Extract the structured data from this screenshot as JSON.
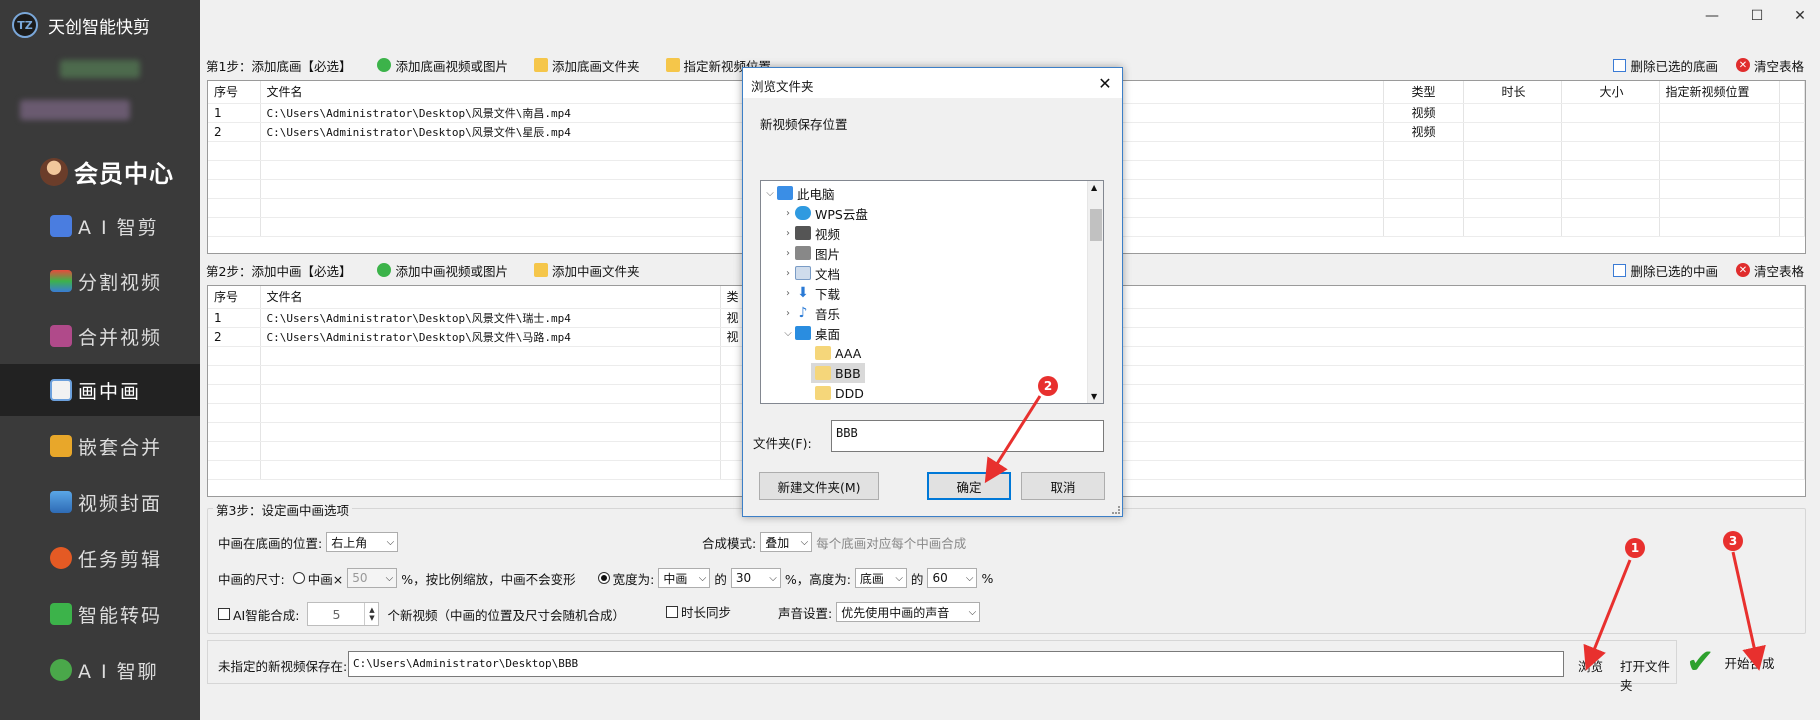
{
  "app": {
    "title": "天创智能快剪",
    "logo_text": "TZ"
  },
  "window": {
    "minimize": "—",
    "maximize": "☐",
    "close": "✕"
  },
  "sidebar": {
    "member_label": "会员中心",
    "items": [
      {
        "label": "A I 智剪",
        "icon": "ai-edit-icon",
        "color": "#4a7de0"
      },
      {
        "label": "分割视频",
        "icon": "split-video-icon",
        "color": "#3cb34a"
      },
      {
        "label": "合并视频",
        "icon": "merge-video-icon",
        "color": "#b04a8a"
      },
      {
        "label": "画中画",
        "icon": "picture-in-picture-icon",
        "color": "#6ca0dc",
        "active": true
      },
      {
        "label": "嵌套合并",
        "icon": "nested-merge-icon",
        "color": "#e8a72a"
      },
      {
        "label": "视频封面",
        "icon": "video-cover-icon",
        "color": "#3a7bd5"
      },
      {
        "label": "任务剪辑",
        "icon": "task-edit-icon",
        "color": "#e45a24"
      },
      {
        "label": "智能转码",
        "icon": "transcode-icon",
        "color": "#3cb34a"
      },
      {
        "label": "A I 智聊",
        "icon": "ai-chat-icon",
        "color": "#4aa84a"
      }
    ]
  },
  "step1": {
    "title": "第1步：添加底画【必选】",
    "add_media": "添加底画视频或图片",
    "add_folder": "添加底画文件夹",
    "set_location": "指定新视频位置",
    "delete_selected": "删除已选的底画",
    "clear_table": "清空表格",
    "columns": [
      "序号",
      "文件名",
      "类型",
      "时长",
      "大小",
      "指定新视频位置"
    ],
    "rows": [
      {
        "index": "1",
        "filename": "C:\\Users\\Administrator\\Desktop\\风景文件\\南昌.mp4",
        "type": "视频"
      },
      {
        "index": "2",
        "filename": "C:\\Users\\Administrator\\Desktop\\风景文件\\星辰.mp4",
        "type": "视频"
      }
    ]
  },
  "step2": {
    "title": "第2步：添加中画【必选】",
    "add_media": "添加中画视频或图片",
    "add_folder": "添加中画文件夹",
    "delete_selected": "删除已选的中画",
    "clear_table": "清空表格",
    "columns": [
      "序号",
      "文件名",
      "类"
    ],
    "rows": [
      {
        "index": "1",
        "filename": "C:\\Users\\Administrator\\Desktop\\风景文件\\瑞士.mp4",
        "type": "视"
      },
      {
        "index": "2",
        "filename": "C:\\Users\\Administrator\\Desktop\\风景文件\\马路.mp4",
        "type": "视"
      }
    ]
  },
  "step3": {
    "title": "第3步：设定画中画选项",
    "position_label": "中画在底画的位置:",
    "position_value": "右上角",
    "blend_label": "合成模式:",
    "blend_value": "叠加",
    "blend_note": "每个底画对应每个中画合成",
    "size_label": "中画的尺寸:",
    "scale_option": "中画×",
    "scale_value": "50",
    "scale_note": "%，按比例缩放，中画不会变形",
    "width_option": "宽度为:",
    "width_ref": "中画",
    "of1": "的",
    "width_pct": "30",
    "height_label": "%，高度为:",
    "height_ref": "底画",
    "of2": "的",
    "height_pct": "60",
    "pct": "%",
    "ai_label": "AI智能合成:",
    "ai_count": "5",
    "ai_note": "个新视频（中画的位置及尺寸会随机合成）",
    "sync_label": "时长同步",
    "audio_label": "声音设置:",
    "audio_value": "优先使用中画的声音"
  },
  "bottom": {
    "save_label": "未指定的新视频保存在:",
    "save_path": "C:\\Users\\Administrator\\Desktop\\BBB",
    "browse": "浏览",
    "open_folder": "打开文件夹",
    "start": "开始合成"
  },
  "dialog": {
    "title": "浏览文件夹",
    "description": "新视频保存位置",
    "tree": [
      {
        "label": "此电脑",
        "icon": "computer-icon",
        "color": "#3a8ee6",
        "expanded": true
      },
      {
        "label": "WPS云盘",
        "icon": "cloud-icon",
        "color": "#2f9ae0"
      },
      {
        "label": "视频",
        "icon": "video-folder-icon",
        "color": "#555"
      },
      {
        "label": "图片",
        "icon": "pictures-folder-icon",
        "color": "#555"
      },
      {
        "label": "文档",
        "icon": "documents-folder-icon",
        "color": "#7a9cc6"
      },
      {
        "label": "下载",
        "icon": "downloads-folder-icon",
        "color": "#2a7ad5"
      },
      {
        "label": "音乐",
        "icon": "music-folder-icon",
        "color": "#2a7ad5"
      },
      {
        "label": "桌面",
        "icon": "desktop-folder-icon",
        "color": "#2a8de0",
        "expanded": true
      },
      {
        "label": "AAA",
        "icon": "folder-icon",
        "color": "#f5d67a"
      },
      {
        "label": "BBB",
        "icon": "folder-icon",
        "color": "#f5d67a",
        "selected": true
      },
      {
        "label": "DDD",
        "icon": "folder-icon",
        "color": "#f5d67a"
      }
    ],
    "folder_label": "文件夹(F):",
    "folder_value": "BBB",
    "new_folder": "新建文件夹(M)",
    "ok": "确定",
    "cancel": "取消"
  },
  "annotations": {
    "badge1": "1",
    "badge2": "2",
    "badge3": "3",
    "color": "#e8302e"
  }
}
